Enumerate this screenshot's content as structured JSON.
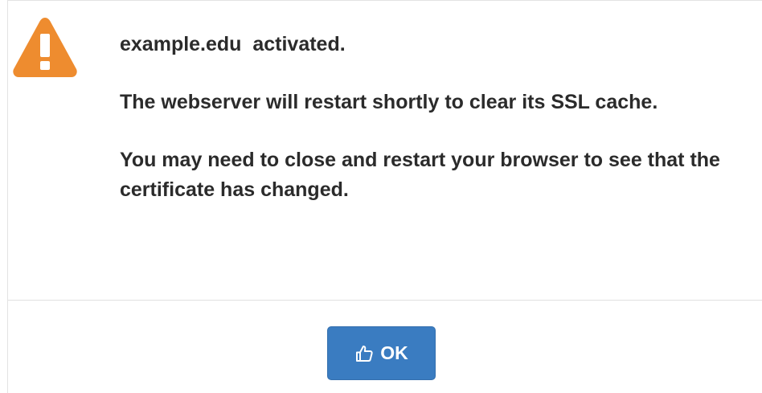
{
  "dialog": {
    "icon": "warning-icon",
    "icon_color": "#EE8C2F",
    "messages": [
      "example.edu  activated.",
      "The webserver will restart shortly to clear its SSL cache.",
      "You may need to close and restart your browser to see that the certificate has changed."
    ],
    "ok_button": {
      "label": "OK",
      "icon": "thumbs-up-icon",
      "color": "#3A7CC1"
    }
  }
}
